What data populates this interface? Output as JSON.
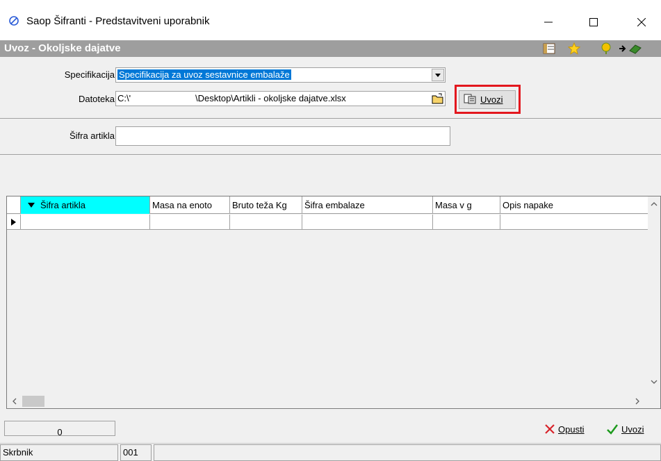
{
  "window": {
    "title": "Saop Šifranti - Predstavitveni uporabnik"
  },
  "header": {
    "title": "Uvoz - Okoljske dajatve"
  },
  "form": {
    "spec_label": "Specifikacija",
    "spec_value": "Specifikacija za uvoz sestavnice embalaže",
    "file_label": "Datoteka",
    "file_value_part1": "C:\\'",
    "file_value_part2": "\\Desktop\\Artikli - okoljske dajatve.xlsx",
    "import_label": "Uvozi",
    "item_label": "Šifra artikla",
    "item_value": ""
  },
  "grid": {
    "columns": [
      "Šifra artikla",
      "Masa na enoto",
      "Bruto teža Kg",
      "Šifra embalaze",
      "Masa v g",
      "Opis napake"
    ]
  },
  "footer": {
    "count": "0",
    "cancel_label": "Opusti",
    "import_label": "Uvozi"
  },
  "status": {
    "user": "Skrbnik",
    "code": "001"
  },
  "colors": {
    "highlight": "#e3171e",
    "sorted_column": "#00ffff",
    "selection": "#0078d7",
    "header_band": "#9e9e9e"
  }
}
